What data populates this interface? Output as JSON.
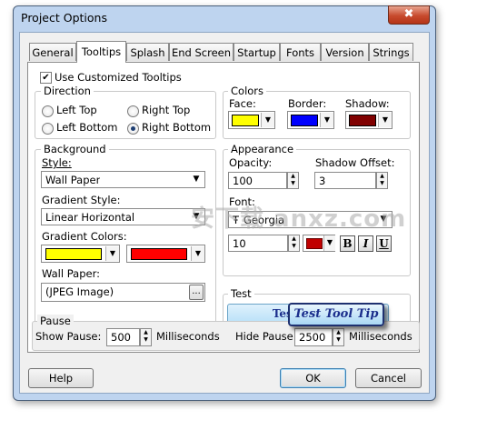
{
  "window": {
    "title": "Project Options",
    "close_glyph": "✖"
  },
  "tabs": [
    {
      "label": "General",
      "active": false
    },
    {
      "label": "Tooltips",
      "active": true
    },
    {
      "label": "Splash",
      "active": false
    },
    {
      "label": "End Screen",
      "active": false
    },
    {
      "label": "Startup",
      "active": false
    },
    {
      "label": "Fonts",
      "active": false
    },
    {
      "label": "Version",
      "active": false
    },
    {
      "label": "Strings",
      "active": false
    }
  ],
  "use_customized": {
    "label": "Use Customized Tooltips",
    "checked": true,
    "check_glyph": "✔"
  },
  "direction": {
    "legend": "Direction",
    "options": [
      "Left Top",
      "Right Top",
      "Left Bottom",
      "Right Bottom"
    ],
    "selected": "Right Bottom"
  },
  "colors": {
    "legend": "Colors",
    "face_label": "Face:",
    "border_label": "Border:",
    "shadow_label": "Shadow:",
    "face_color": "#ffff00",
    "border_color": "#0000ff",
    "shadow_color": "#800000"
  },
  "background": {
    "legend": "Background",
    "style_label": "Style:",
    "style_value": "Wall Paper",
    "gradient_style_label": "Gradient Style:",
    "gradient_style_value": "Linear Horizontal",
    "gradient_colors_label": "Gradient Colors:",
    "gradient_color_1": "#ffff00",
    "gradient_color_2": "#ff0000",
    "wallpaper_label": "Wall Paper:",
    "wallpaper_value": "(JPEG Image)",
    "browse_label": "..."
  },
  "appearance": {
    "legend": "Appearance",
    "opacity_label": "Opacity:",
    "opacity_value": "100",
    "shadow_offset_label": "Shadow Offset:",
    "shadow_offset_value": "3",
    "font_label": "Font:",
    "font_value": "Georgia",
    "font_icon": "Ŧ",
    "size_value": "10",
    "font_color": "#c00000",
    "bold_label": "B",
    "italic_label": "I",
    "underline_label": "U"
  },
  "test": {
    "legend": "Test",
    "button_label": "Test Button",
    "tooltip_text": "Test Tool Tip"
  },
  "pause": {
    "legend": "Pause",
    "show_label": "Show Pause:",
    "show_value": "500",
    "hide_label": "Hide Pause:",
    "hide_value": "2500",
    "unit": "Milliseconds"
  },
  "buttons": {
    "help": "Help",
    "ok": "OK",
    "cancel": "Cancel"
  },
  "watermark": "安下载 anxz.com"
}
